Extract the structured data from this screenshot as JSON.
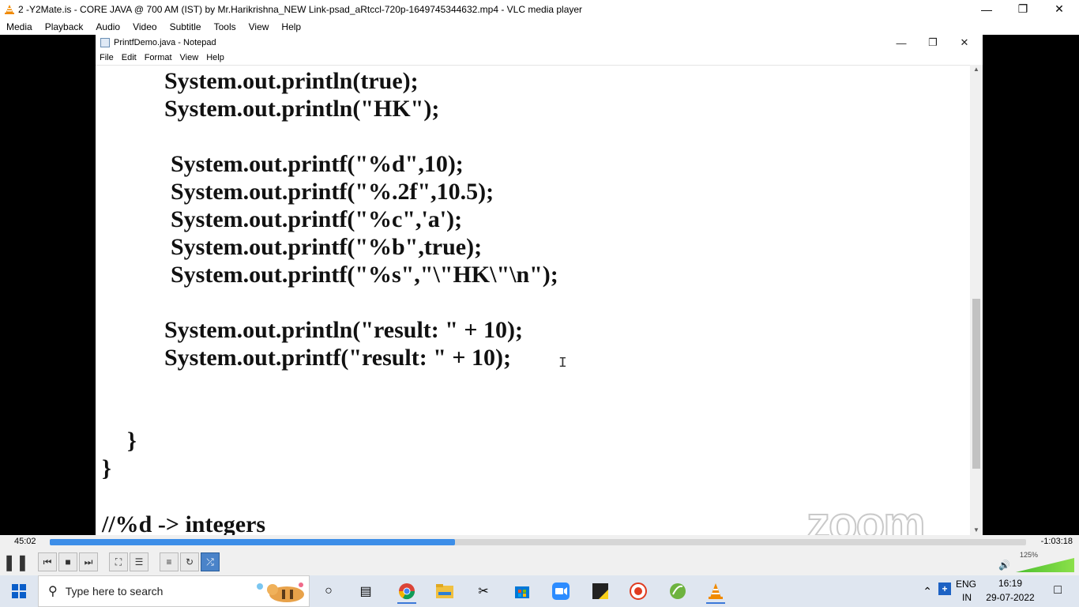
{
  "vlc": {
    "title": "2 -Y2Mate.is - CORE JAVA @ 700 AM (IST) by Mr.Harikrishna_NEW Link-psad_aRtccl-720p-1649745344632.mp4 - VLC media player",
    "menu": [
      "Media",
      "Playback",
      "Audio",
      "Video",
      "Subtitle",
      "Tools",
      "View",
      "Help"
    ],
    "elapsed": "45:02",
    "remaining": "-1:03:18",
    "progress": 0.415,
    "volume_label": "125%",
    "volume_level": 1.0
  },
  "notepad": {
    "title": "PrintfDemo.java - Notepad",
    "menu": [
      "File",
      "Edit",
      "Format",
      "View",
      "Help"
    ],
    "code_lines": [
      "System.out.println(true);",
      "System.out.println(\"HK\");",
      "System.out.printf(\"%d\",10);",
      "System.out.printf(\"%.2f\",10.5);",
      "System.out.printf(\"%c\",'a');",
      "System.out.printf(\"%b\",true);",
      "System.out.printf(\"%s\",\"\\\"HK\\\"\\n\");",
      "System.out.println(\"result: \" + 10);",
      "System.out.printf(\"result: \" + 10);",
      "}",
      "}",
      "//%d -> integers"
    ],
    "watermark": "zoom"
  },
  "taskbar": {
    "search_placeholder": "Type here to search",
    "language_top": "ENG",
    "language_bottom": "IN",
    "time": "16:19",
    "date": "29-07-2022"
  },
  "colors": {
    "seek_fill": "#3d8ee8",
    "vlc_orange": "#f08a00",
    "taskbar": "#dfe6f0"
  }
}
